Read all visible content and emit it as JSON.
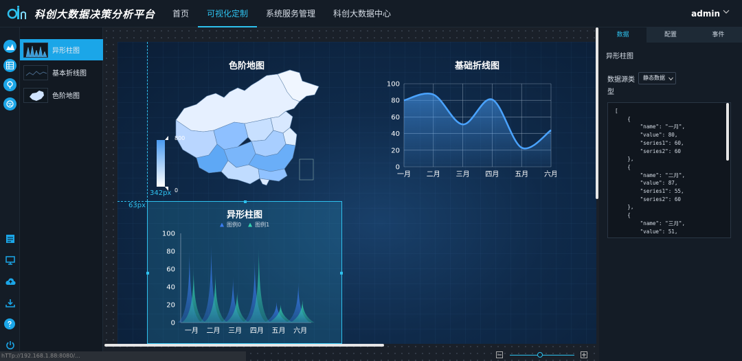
{
  "app": {
    "title": "科创大数据决策分析平台"
  },
  "nav": [
    {
      "label": "首页",
      "active": false
    },
    {
      "label": "可视化定制",
      "active": true
    },
    {
      "label": "系统服务管理",
      "active": false
    },
    {
      "label": "科创大数据中心",
      "active": false
    }
  ],
  "user": {
    "name": "admin"
  },
  "components": [
    {
      "label": "异形柱图",
      "active": true
    },
    {
      "label": "基本折线图",
      "active": false
    },
    {
      "label": "色阶地图",
      "active": false
    }
  ],
  "guides": {
    "h_label": "342px",
    "v_label": "63px"
  },
  "map": {
    "title": "色阶地图",
    "legend_max": "800",
    "legend_min": "0"
  },
  "status": {
    "text": "hTTp://192.168.1.88:8080/..."
  },
  "right_panel": {
    "tabs": [
      {
        "label": "数据",
        "active": true
      },
      {
        "label": "配置",
        "active": false
      },
      {
        "label": "事件",
        "active": false
      }
    ],
    "component_name": "异形柱图",
    "source_label": "数据源类型",
    "source_value": "静态数据",
    "code": "[\n    {\n        \"name\": \"一月\",\n        \"value\": 80,\n        \"series1\": 60,\n        \"series2\": 60\n    },\n    {\n        \"name\": \"二月\",\n        \"value\": 87,\n        \"series1\": 55,\n        \"series2\": 60\n    },\n    {\n        \"name\": \"三月\",\n        \"value\": 51,"
  },
  "chart_data": [
    {
      "type": "line",
      "title": "基础折线图",
      "categories": [
        "一月",
        "二月",
        "三月",
        "四月",
        "五月",
        "六月"
      ],
      "values": [
        80,
        87,
        51,
        81,
        23,
        44
      ],
      "ylim": [
        0,
        100
      ],
      "yticks": [
        0,
        20,
        40,
        60,
        80,
        100
      ],
      "grid": true,
      "color": "#4aa3ff"
    },
    {
      "type": "bar",
      "title": "异形柱图",
      "categories": [
        "一月",
        "二月",
        "三月",
        "四月",
        "五月",
        "六月"
      ],
      "series": [
        {
          "name": "图例0",
          "values": [
            80,
            87,
            51,
            70,
            23,
            45
          ],
          "color": "#3a7cf0"
        },
        {
          "name": "图例1",
          "values": [
            60,
            55,
            35,
            83,
            20,
            25
          ],
          "color": "#35d4b0"
        }
      ],
      "ylim": [
        0,
        100
      ],
      "yticks": [
        0,
        20,
        40,
        60,
        80,
        100
      ],
      "legend": "top",
      "grid": false
    }
  ]
}
